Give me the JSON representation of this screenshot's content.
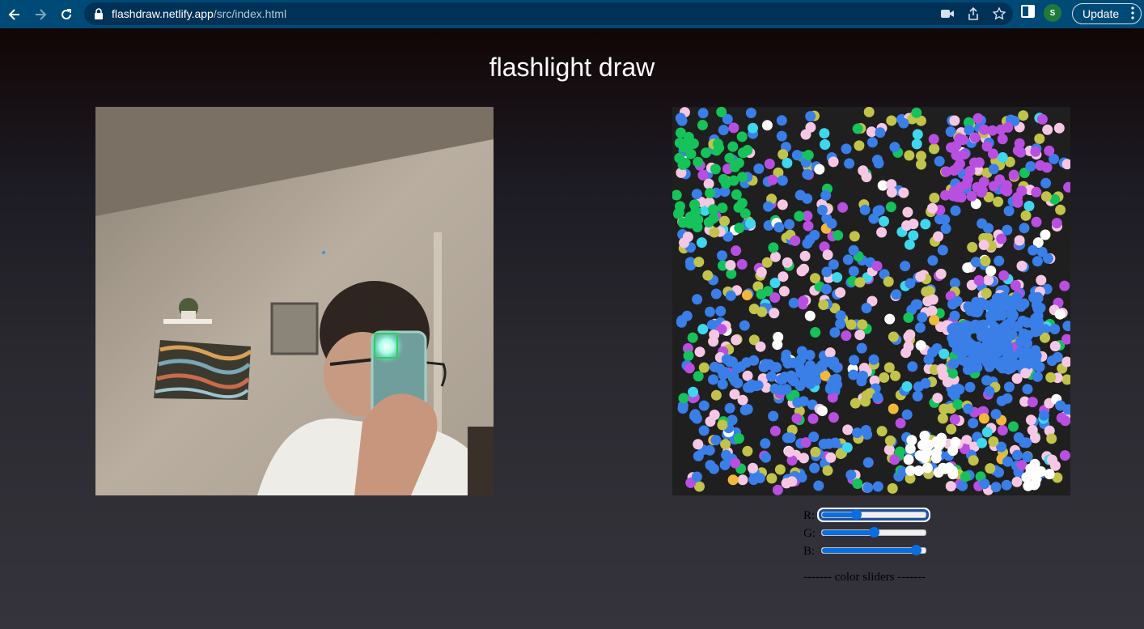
{
  "browser": {
    "url_domain": "flashdraw.netlify.app",
    "url_path": "/src/index.html",
    "avatar_initial": "S",
    "update_label": "Update"
  },
  "page": {
    "title": "flashlight draw"
  },
  "sliders": {
    "items": [
      {
        "label": "R:",
        "value": 0.33
      },
      {
        "label": "G:",
        "value": 0.5
      },
      {
        "label": "B:",
        "value": 0.91
      }
    ],
    "caption": "------- color sliders -------"
  },
  "colors": {
    "accent": "#0a6de0",
    "chrome": "#004a77",
    "omnibox": "#003156",
    "dots": [
      "#3a7ee8",
      "#f6c7e4",
      "#c2c34a",
      "#b94fe0",
      "#16c25a",
      "#ffffff",
      "#3fd6ee",
      "#f0b93a"
    ]
  }
}
